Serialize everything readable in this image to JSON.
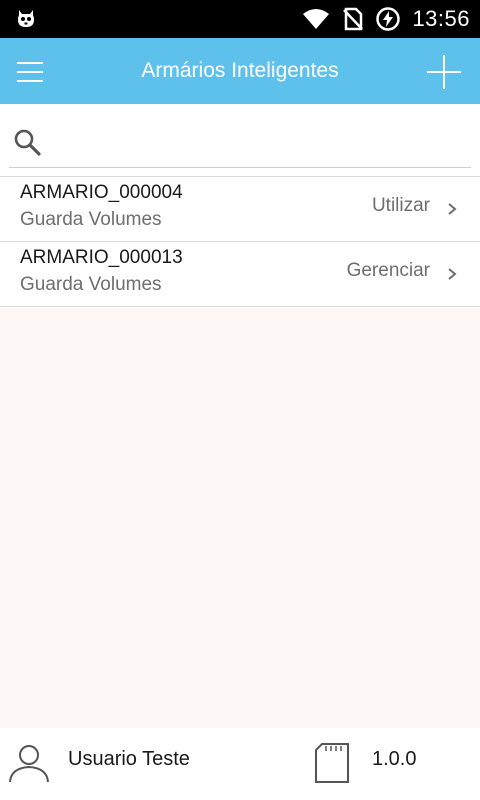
{
  "status_bar": {
    "time": "13:56",
    "icons": [
      "app-notification-icon",
      "wifi-icon",
      "no-sim-icon",
      "battery-charging-icon"
    ]
  },
  "app_bar": {
    "title": "Armários Inteligentes",
    "menu_icon": "hamburger-menu-icon",
    "add_icon": "plus-icon",
    "background": "#5ec1ec"
  },
  "search": {
    "icon": "search-icon",
    "value": "",
    "placeholder": ""
  },
  "lockers": [
    {
      "name": "ARMARIO_000004",
      "type": "Guarda Volumes",
      "action": "Utilizar"
    },
    {
      "name": "ARMARIO_000013",
      "type": "Guarda Volumes",
      "action": "Gerenciar"
    }
  ],
  "footer": {
    "user_icon": "user-icon",
    "user_name": "Usuario Teste",
    "storage_icon": "sd-card-icon",
    "version": "1.0.0"
  }
}
